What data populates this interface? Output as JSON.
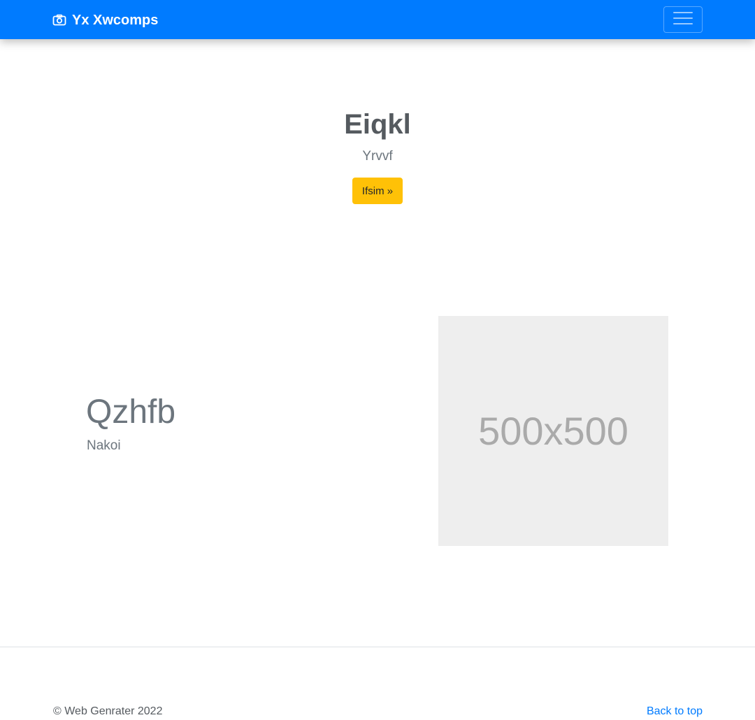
{
  "navbar": {
    "brand_icon": "camera-icon",
    "brand_text": "Yx Xwcomps",
    "toggler_icon": "hamburger-menu-icon",
    "background": "#007bff"
  },
  "hero": {
    "title": "Eiqkl",
    "subtitle": "Yrvvf",
    "button_label": "Ifsim »",
    "button_color": "#ffc107"
  },
  "feature": {
    "heading": "Qzhfb",
    "text": "Nakoi",
    "image_placeholder": "500x500"
  },
  "footer": {
    "copyright": "© Web Genrater 2022",
    "back_to_top": "Back to top"
  }
}
